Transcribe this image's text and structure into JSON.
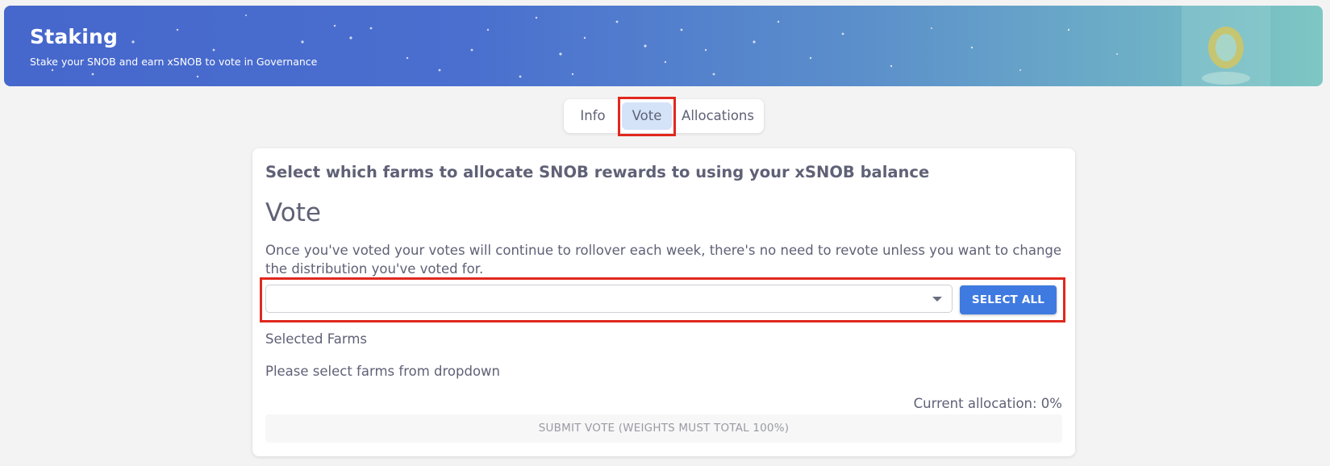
{
  "banner": {
    "title": "Staking",
    "subtitle": "Stake your SNOB and earn xSNOB to vote in Governance",
    "mascot_icon": "snowball-mascot-icon"
  },
  "tabs": [
    {
      "label": "Info",
      "active": false
    },
    {
      "label": "Vote",
      "active": true
    },
    {
      "label": "Allocations",
      "active": false
    }
  ],
  "vote": {
    "heading": "Select which farms to allocate SNOB rewards to using your xSNOB balance",
    "title": "Vote",
    "description": "Once you've voted your votes will continue to rollover each week, there's no need to revote unless you want to change the distribution you've voted for.",
    "farm_select_value": "",
    "select_all_label": "SELECT ALL",
    "selected_farms_label": "Selected Farms",
    "empty_message": "Please select farms from dropdown",
    "current_allocation": "Current allocation: 0%",
    "submit_label": "SUBMIT VOTE (WEIGHTS MUST TOTAL 100%)"
  },
  "colors": {
    "accent": "#3f7ae0",
    "highlight": "#e0281e",
    "active_tab_bg": "#d4e3f8",
    "text": "#5f6176"
  }
}
